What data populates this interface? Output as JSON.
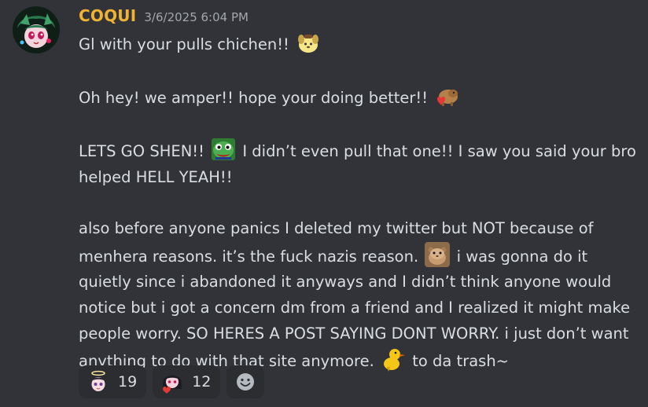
{
  "message": {
    "author": "COQUI",
    "author_color": "#f0b232",
    "timestamp": "3/6/2025 6:04 PM",
    "avatar_icon": "anime-avatar-icon",
    "lines": {
      "p1": "Gl with your pulls chichen!!",
      "p2": "Oh hey! we amper!! hope your doing better!!",
      "p3a": "LETS GO SHEN!!",
      "p3b": "I didn’t even pull that one!! I saw you said your bro helped HELL YEAH!!",
      "p4a": "also before anyone panics I deleted my twitter but NOT because of menhera reasons. it’s the fuck nazis reason.",
      "p4b": "i was gonna do it quietly since i abandoned it anyways and I didn’t think anyone would notice but i got a concern dm from a friend and I realized it might make people worry. SO HERES A POST SAYING DONT WORRY. i just don’t want anything to do with that site anymore.",
      "p4c": "to da trash~"
    },
    "emojis": {
      "e1": "dog-pudding-emoji-icon",
      "e2": "capybara-heart-emoji-icon",
      "e3": "pepe-frog-emoji-icon",
      "e4": "hamster-emoji-icon",
      "e5": "duck-emoji-icon"
    }
  },
  "reactions": [
    {
      "icon": "angel-girl-icon",
      "count": "19"
    },
    {
      "icon": "heart-girl-icon",
      "count": "12"
    },
    {
      "icon": "add-reaction-icon"
    }
  ]
}
